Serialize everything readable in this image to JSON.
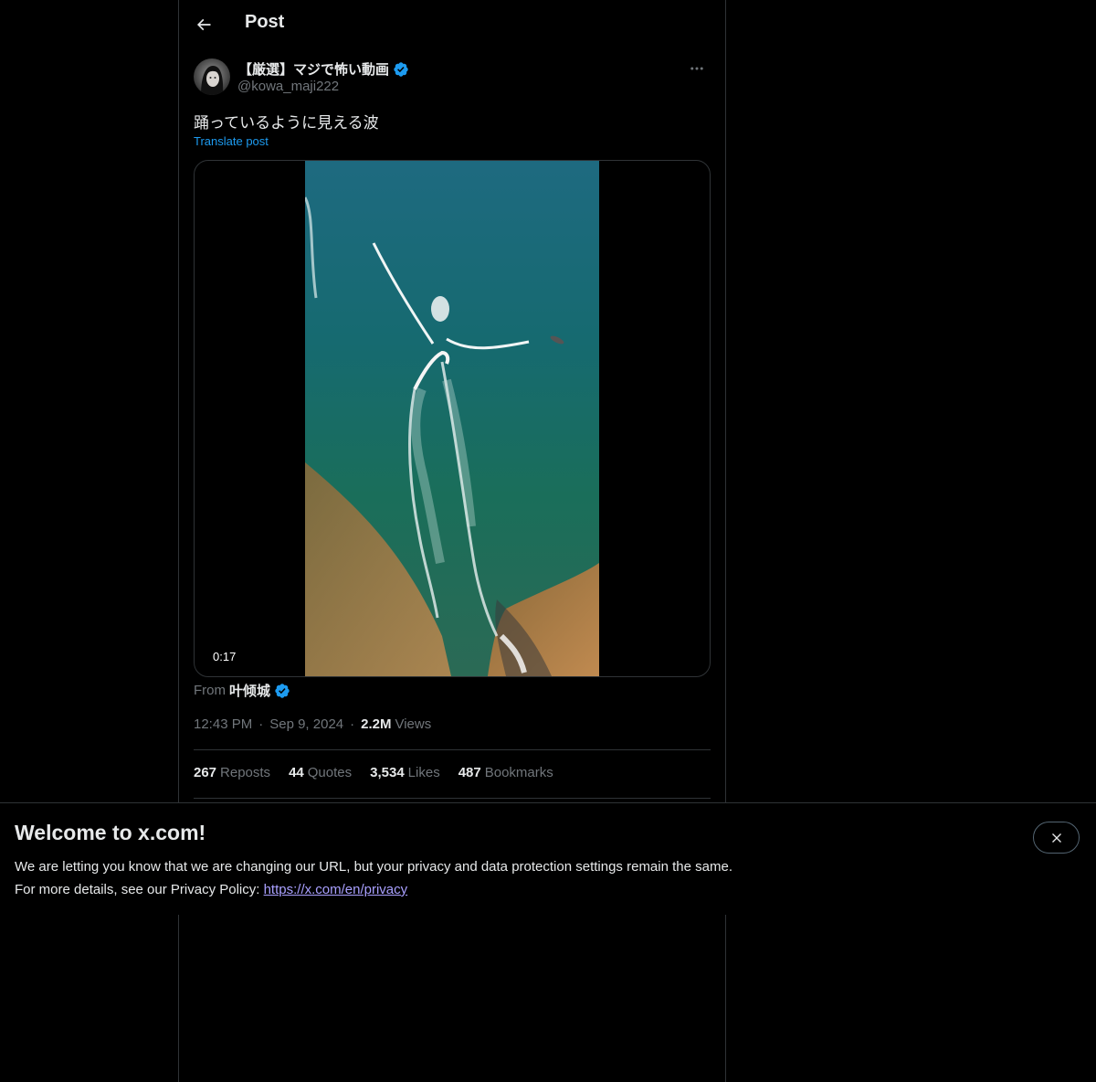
{
  "header": {
    "title": "Post",
    "back_icon": "arrow-left-icon"
  },
  "post": {
    "author": {
      "display_name": "【厳選】マジで怖い動画",
      "handle": "@kowa_maji222",
      "verified": true
    },
    "text": "踊っているように見える波",
    "translate_label": "Translate post",
    "media": {
      "type": "video",
      "duration": "0:17"
    },
    "from": {
      "prefix": "From",
      "name": "叶倾城",
      "verified": true
    },
    "time": "12:43 PM",
    "date": "Sep 9, 2024",
    "views_count": "2.2M",
    "views_label": "Views",
    "stats": [
      {
        "count": "267",
        "label": "Reposts"
      },
      {
        "count": "44",
        "label": "Quotes"
      },
      {
        "count": "3,534",
        "label": "Likes"
      },
      {
        "count": "487",
        "label": "Bookmarks"
      }
    ]
  },
  "banner": {
    "title": "Welcome to x.com!",
    "line1": "We are letting you know that we are changing our URL, but your privacy and data protection settings remain the same.",
    "line2_prefix": "For more details, see our Privacy Policy: ",
    "link": "https://x.com/en/privacy",
    "close_icon": "close-icon"
  },
  "colors": {
    "background": "#000000",
    "text": "#e7e9ea",
    "muted": "#71767b",
    "accent": "#1d9bf0",
    "verified": "#1d9bf0",
    "border": "#2f3336",
    "link": "#a9a0ff"
  }
}
